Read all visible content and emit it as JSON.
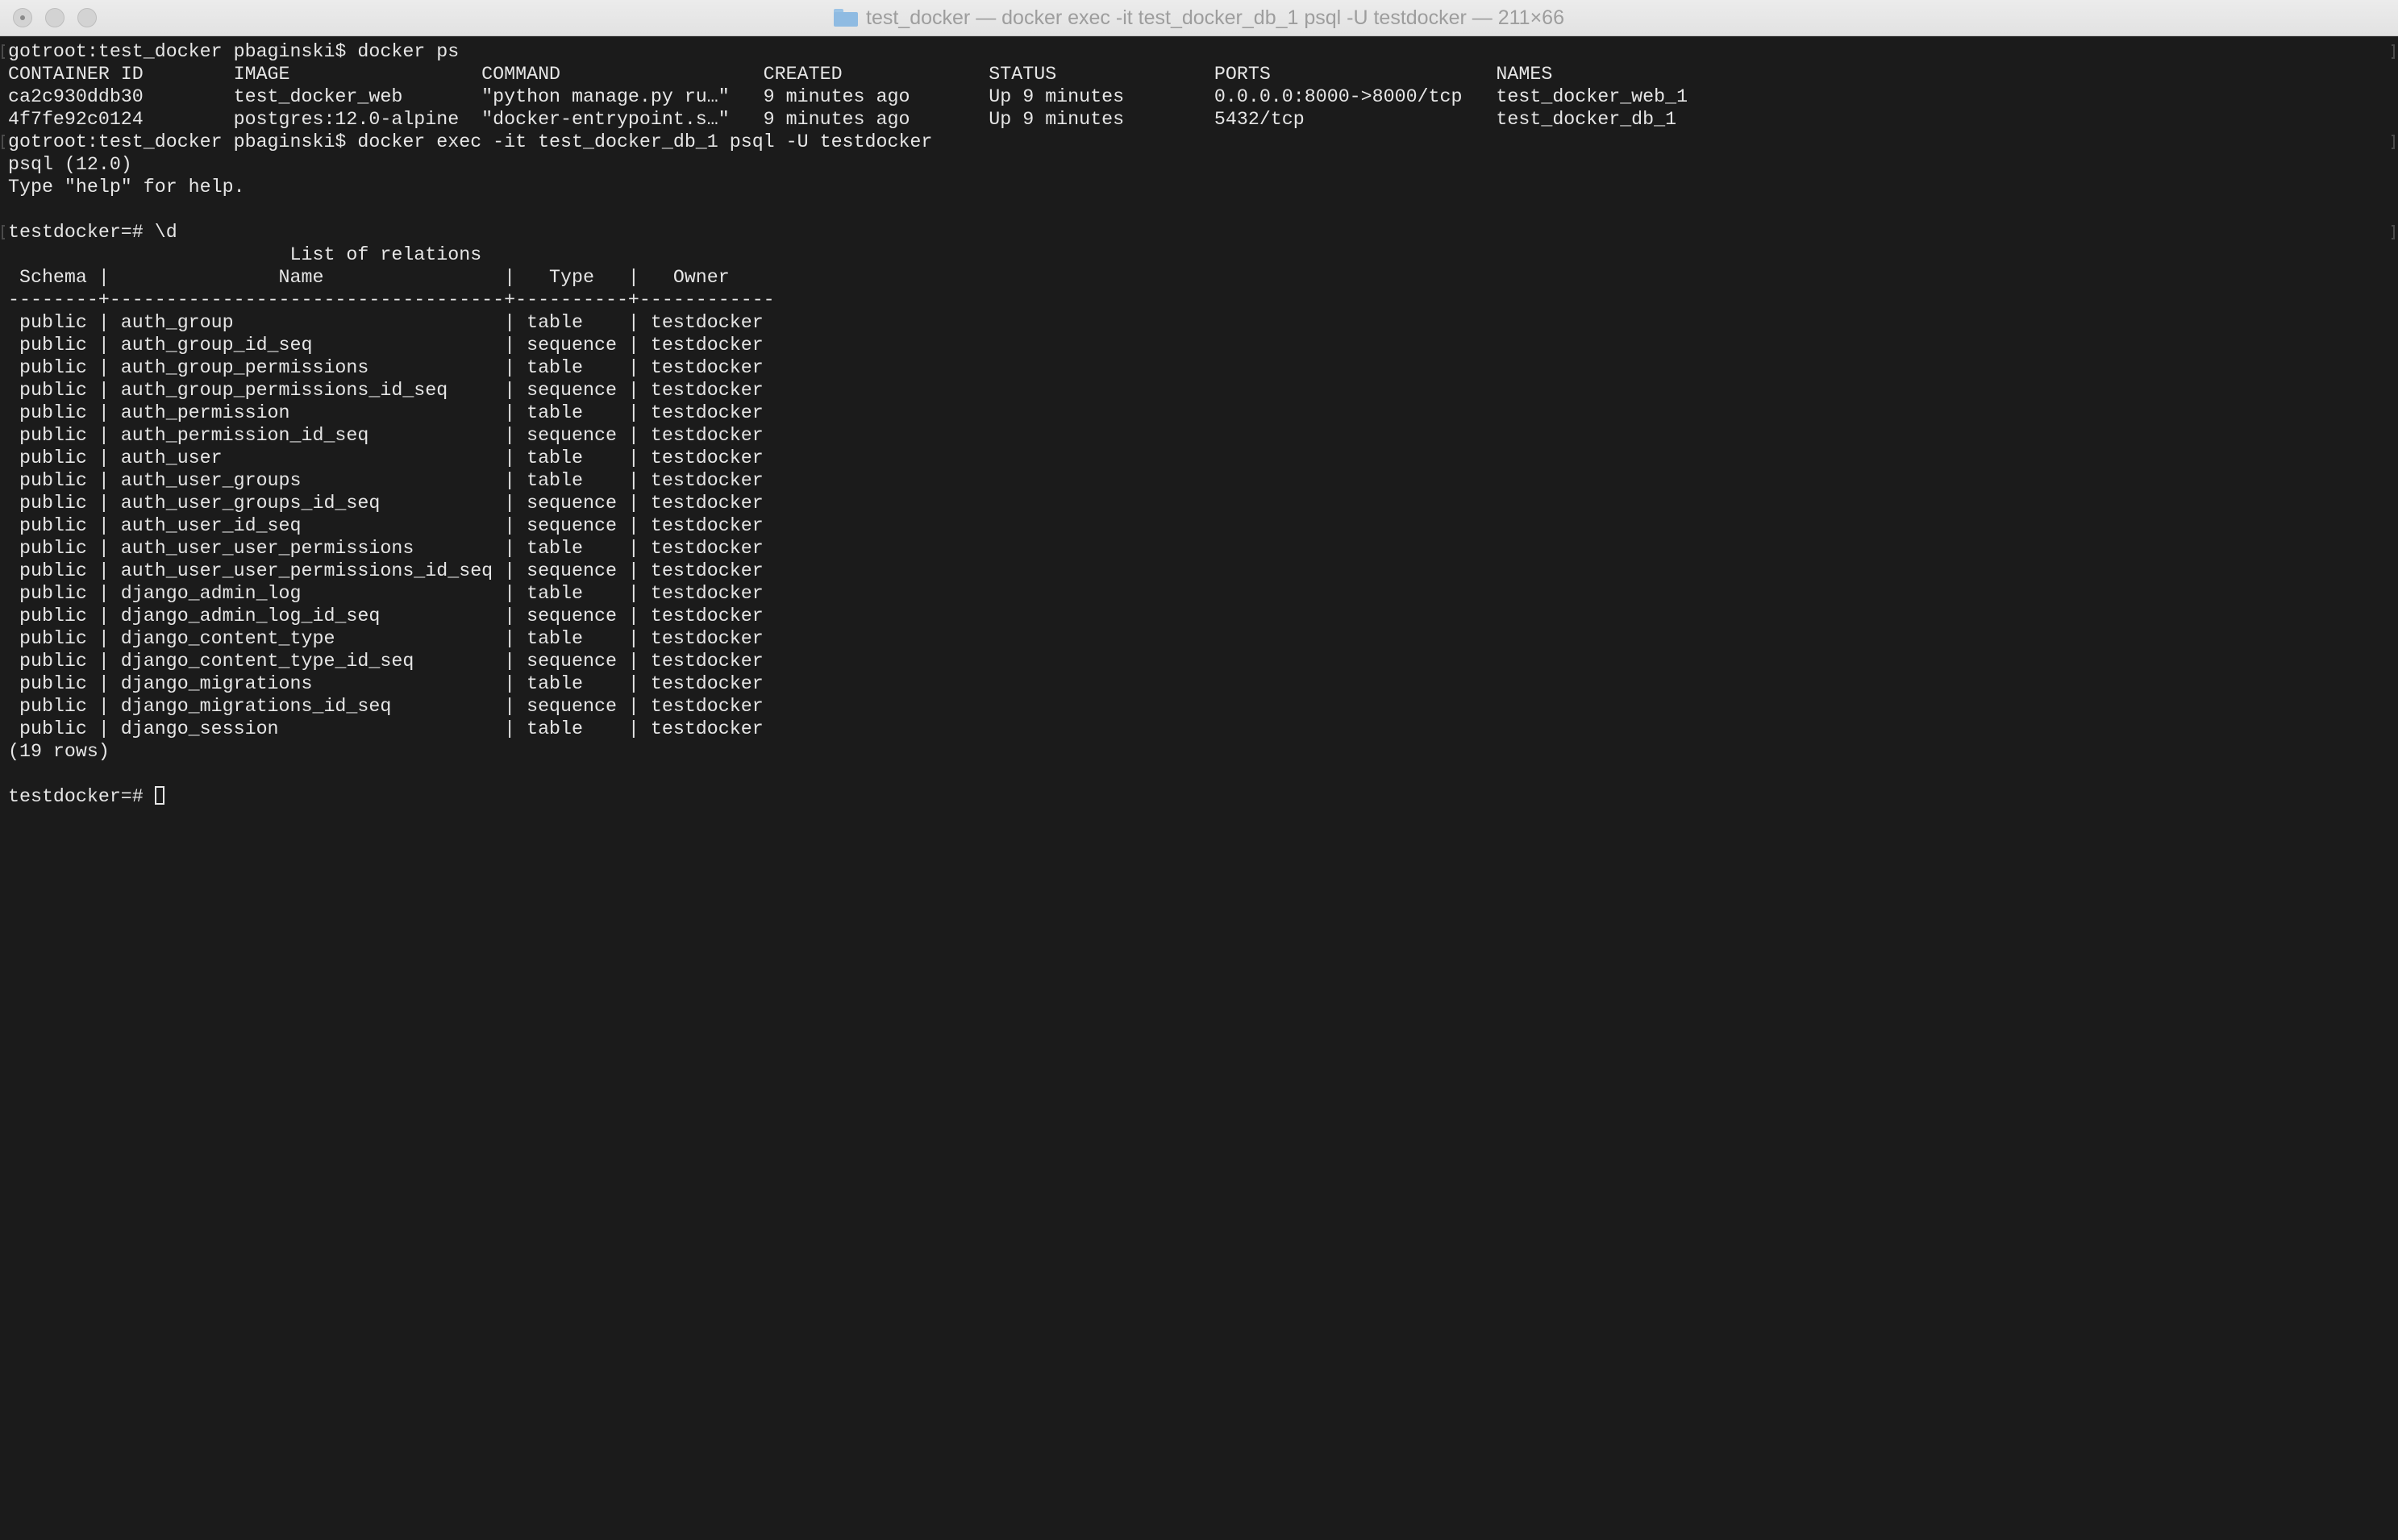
{
  "window": {
    "title": "test_docker — docker exec -it test_docker_db_1 psql -U testdocker — 211×66"
  },
  "terminal": {
    "lines": [
      "gotroot:test_docker pbaginski$ docker ps",
      "CONTAINER ID        IMAGE                 COMMAND                  CREATED             STATUS              PORTS                    NAMES",
      "ca2c930ddb30        test_docker_web       \"python manage.py ru…\"   9 minutes ago       Up 9 minutes        0.0.0.0:8000->8000/tcp   test_docker_web_1",
      "4f7fe92c0124        postgres:12.0-alpine  \"docker-entrypoint.s…\"   9 minutes ago       Up 9 minutes        5432/tcp                 test_docker_db_1",
      "gotroot:test_docker pbaginski$ docker exec -it test_docker_db_1 psql -U testdocker",
      "psql (12.0)",
      "Type \"help\" for help.",
      "",
      "testdocker=# \\d",
      "                         List of relations",
      " Schema |               Name                |   Type   |   Owner",
      "--------+-----------------------------------+----------+------------",
      " public | auth_group                        | table    | testdocker",
      " public | auth_group_id_seq                 | sequence | testdocker",
      " public | auth_group_permissions            | table    | testdocker",
      " public | auth_group_permissions_id_seq     | sequence | testdocker",
      " public | auth_permission                   | table    | testdocker",
      " public | auth_permission_id_seq            | sequence | testdocker",
      " public | auth_user                         | table    | testdocker",
      " public | auth_user_groups                  | table    | testdocker",
      " public | auth_user_groups_id_seq           | sequence | testdocker",
      " public | auth_user_id_seq                  | sequence | testdocker",
      " public | auth_user_user_permissions        | table    | testdocker",
      " public | auth_user_user_permissions_id_seq | sequence | testdocker",
      " public | django_admin_log                  | table    | testdocker",
      " public | django_admin_log_id_seq           | sequence | testdocker",
      " public | django_content_type               | table    | testdocker",
      " public | django_content_type_id_seq        | sequence | testdocker",
      " public | django_migrations                 | table    | testdocker",
      " public | django_migrations_id_seq          | sequence | testdocker",
      " public | django_session                    | table    | testdocker",
      "(19 rows)",
      ""
    ],
    "prompt": "testdocker=# "
  },
  "colors": {
    "background": "#1b1b1b",
    "foreground": "#e6e6e6",
    "titlebar": "#e6e6e6",
    "title_text": "#9d9d9d"
  },
  "icons": {
    "title_folder": "folder-icon"
  }
}
